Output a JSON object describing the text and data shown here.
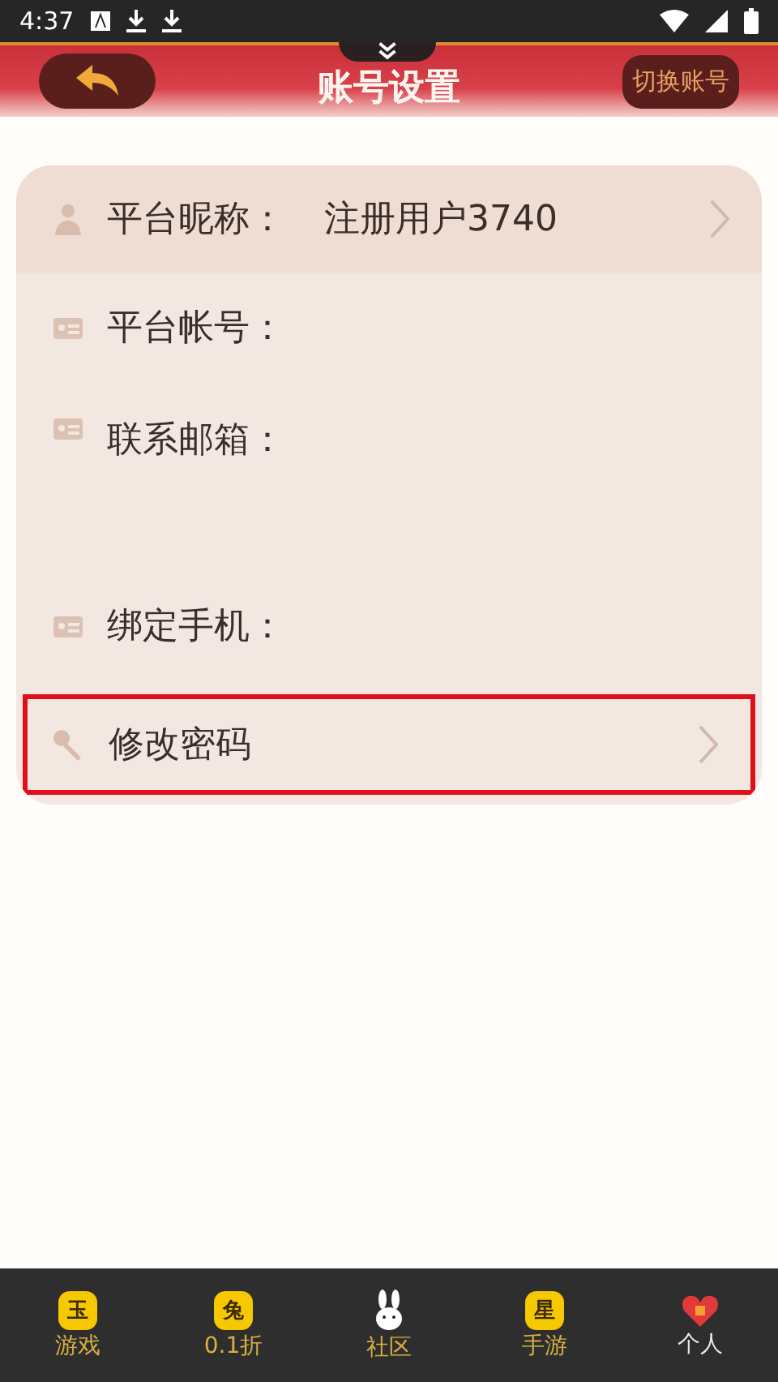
{
  "status_bar": {
    "time": "4:37"
  },
  "header": {
    "title": "账号设置",
    "switch_button": "切换账号"
  },
  "rows": [
    {
      "kind": "profile",
      "label": "平台昵称：",
      "value": "注册用户3740",
      "highlighted": false
    },
    {
      "kind": "info",
      "label": "平台帐号：",
      "highlighted": false
    },
    {
      "kind": "info",
      "label": "联系邮箱：",
      "highlighted": false
    },
    {
      "kind": "info",
      "label": "绑定手机：",
      "highlighted": false
    },
    {
      "kind": "password",
      "label": "修改密码",
      "highlighted": true
    }
  ],
  "nav": [
    {
      "kind": "coin",
      "label": "游戏",
      "glyph": "玉",
      "selected": false
    },
    {
      "kind": "coin",
      "label": "0.1折",
      "glyph": "兔",
      "selected": false
    },
    {
      "kind": "rabbit",
      "label": "社区",
      "selected": false
    },
    {
      "kind": "coin",
      "label": "手游",
      "glyph": "星",
      "selected": false
    },
    {
      "kind": "heart",
      "label": "个人",
      "selected": true
    }
  ]
}
